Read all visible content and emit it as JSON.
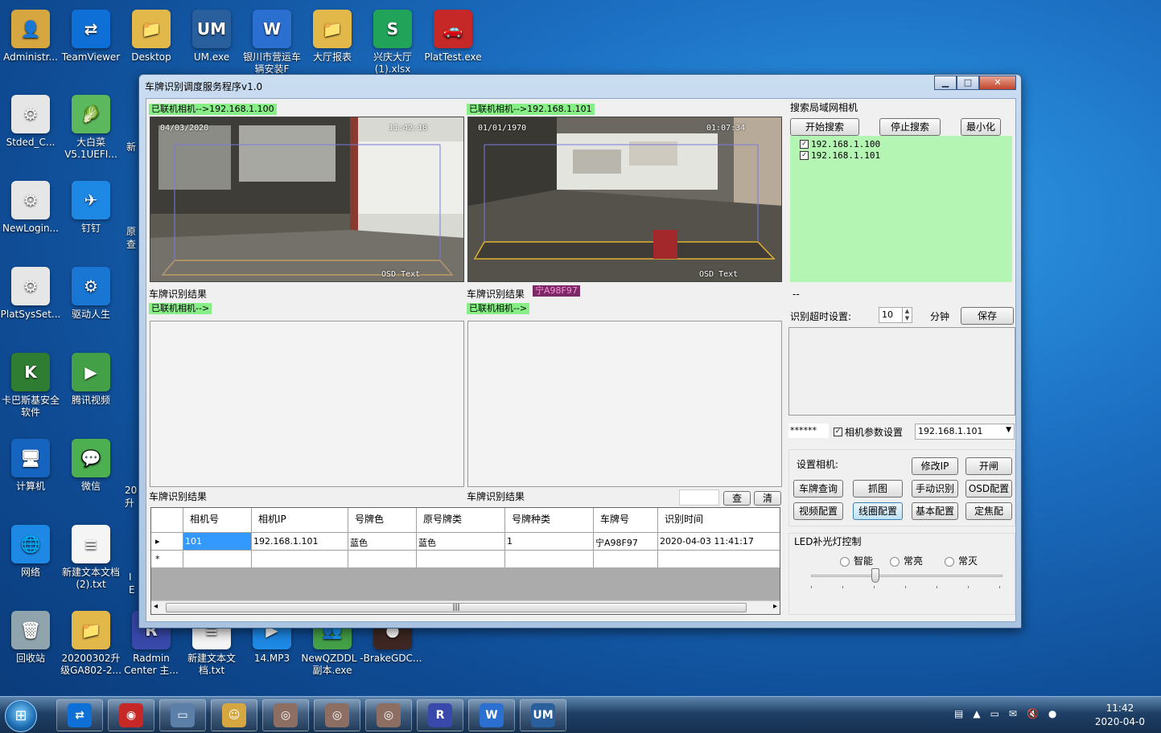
{
  "desktop": {
    "icons": [
      {
        "label": "Administr...",
        "color": "#d6a640",
        "glyph": "👤"
      },
      {
        "label": "TeamViewer",
        "color": "#0e6fd6",
        "glyph": "⇄"
      },
      {
        "label": "Desktop",
        "color": "#e2b84a",
        "glyph": "📁"
      },
      {
        "label": "UM.exe",
        "color": "#2a5f9e",
        "glyph": "UM"
      },
      {
        "label": "银川市营运车辆安装F",
        "color": "#2b6fd0",
        "glyph": "W"
      },
      {
        "label": "大厅报表",
        "color": "#e2b84a",
        "glyph": "📁"
      },
      {
        "label": "兴庆大厅(1).xlsx",
        "color": "#21a35a",
        "glyph": "S"
      },
      {
        "label": "PlatTest.exe",
        "color": "#c62828",
        "glyph": "🚗"
      },
      {
        "label": "Stded_C...",
        "color": "#e6e6e6",
        "glyph": "⚙"
      },
      {
        "label": "大白菜V5.1UEFI...",
        "color": "#5cb85c",
        "glyph": "🥬"
      },
      {
        "label": "NewLogin...",
        "color": "#e6e6e6",
        "glyph": "⚙"
      },
      {
        "label": "钉钉",
        "color": "#1e88e5",
        "glyph": "✈"
      },
      {
        "label": "PlatSysSet...",
        "color": "#e6e6e6",
        "glyph": "⚙"
      },
      {
        "label": "驱动人生",
        "color": "#1976d2",
        "glyph": "⚙"
      },
      {
        "label": "卡巴斯基安全软件",
        "color": "#2e7d32",
        "glyph": "K"
      },
      {
        "label": "腾讯视频",
        "color": "#43a047",
        "glyph": "▶"
      },
      {
        "label": "计算机",
        "color": "#1565c0",
        "glyph": "🖥"
      },
      {
        "label": "微信",
        "color": "#4caf50",
        "glyph": "💬"
      },
      {
        "label": "网络",
        "color": "#1e88e5",
        "glyph": "🌐"
      },
      {
        "label": "新建文本文档 (2).txt",
        "color": "#f5f5f5",
        "glyph": "≡"
      },
      {
        "label": "回收站",
        "color": "#90a4ae",
        "glyph": "🗑"
      },
      {
        "label": "20200302升级GA802-2...",
        "color": "#e2b84a",
        "glyph": "📁"
      },
      {
        "label": "Radmin Center 主...",
        "color": "#3949ab",
        "glyph": "R"
      },
      {
        "label": "新建文本文档.txt",
        "color": "#f5f5f5",
        "glyph": "≡"
      },
      {
        "label": "14.MP3",
        "color": "#1e88e5",
        "glyph": "▶"
      },
      {
        "label": "NewQZDDL - 副本.exe",
        "color": "#43a047",
        "glyph": "👥"
      },
      {
        "label": "BrakeGDC...",
        "color": "#3e2723",
        "glyph": "●"
      }
    ],
    "partial_labels": [
      "新",
      "原\n查",
      "20\n升",
      "I\nE"
    ]
  },
  "window": {
    "title": "车牌识别调度服务程序v1.0",
    "controls": {
      "minimize": "▁",
      "maximize": "□",
      "close": "✕"
    },
    "camera1": {
      "status": "已联机相机-->192.168.1.100",
      "osd_date": "04/03/2020",
      "osd_time": "11:42:18",
      "osd_text": "OSD Text",
      "result_label": "车牌识别结果",
      "result_plate": ""
    },
    "camera2": {
      "status": "已联机相机-->192.168.1.101",
      "osd_date": "01/01/1970",
      "osd_time": "01:07:34",
      "osd_text": "OSD Text",
      "result_label": "车牌识别结果",
      "result_plate": "宁A98F97"
    },
    "camera3": {
      "status": "已联机相机-->",
      "result_label": "车牌识别结果"
    },
    "camera4": {
      "status": "已联机相机-->",
      "result_label": "车牌识别结果"
    },
    "query": {
      "input_value": "",
      "btn_query": "查",
      "btn_clear": "清"
    },
    "search": {
      "title": "搜索局域网相机",
      "start_btn": "开始搜索",
      "stop_btn": "停止搜索",
      "min_btn": "最小化",
      "items": [
        {
          "ip": "192.168.1.100",
          "checked": "✓"
        },
        {
          "ip": "192.168.1.101",
          "checked": "✓"
        }
      ]
    },
    "dash": "--",
    "timeout": {
      "label": "识别超时设置:",
      "value": "10",
      "unit": "分钟",
      "save_btn": "保存"
    },
    "params": {
      "password": "******",
      "checkbox_label": "相机参数设置",
      "checked": "✓",
      "camera_select": "192.168.1.101"
    },
    "camera_settings": {
      "label": "设置相机:",
      "buttons": [
        "修改IP",
        "开闸",
        "车牌查询",
        "抓图",
        "手动识别",
        "OSD配置",
        "视频配置",
        "线圈配置",
        "基本配置",
        "定焦配"
      ]
    },
    "led": {
      "title": "LED补光灯控制",
      "options": [
        "智能",
        "常亮",
        "常灭"
      ],
      "slider_level": 0.33
    },
    "grid": {
      "columns": [
        "",
        "相机号",
        "相机IP",
        "号牌色",
        "原号牌类",
        "号牌种类",
        "车牌号",
        "识别时间"
      ],
      "rows": [
        {
          "indicator": "▸",
          "cells": [
            "101",
            "192.168.1.101",
            "蓝色",
            "蓝色",
            "1",
            "宁A98F97",
            "2020-04-03 11:41:17"
          ]
        },
        {
          "indicator": "*",
          "cells": [
            "",
            "",
            "",
            "",
            "",
            "",
            ""
          ]
        }
      ],
      "scroll_left": "◂",
      "scroll_right": "▸",
      "scroll_grip": "|||"
    }
  },
  "taskbar": {
    "start": "⊞",
    "items": [
      {
        "name": "teamviewer",
        "color": "#0e6fd6",
        "glyph": "⇄"
      },
      {
        "name": "app-colorful",
        "color": "#c62828",
        "glyph": "◉"
      },
      {
        "name": "window",
        "color": "#5c7fa8",
        "glyph": "▭"
      },
      {
        "name": "avatar-app",
        "color": "#d6a640",
        "glyph": "☺"
      },
      {
        "name": "plate-app-1",
        "color": "#8d6e63",
        "glyph": "◎"
      },
      {
        "name": "plate-app-2",
        "color": "#8d6e63",
        "glyph": "◎"
      },
      {
        "name": "plate-app-3",
        "color": "#8d6e63",
        "glyph": "◎"
      },
      {
        "name": "radmin",
        "color": "#3949ab",
        "glyph": "R"
      },
      {
        "name": "wps",
        "color": "#2b6fd0",
        "glyph": "W"
      },
      {
        "name": "um",
        "color": "#2a5f9e",
        "glyph": "UM"
      }
    ],
    "tray": {
      "time": "11:42",
      "date": "2020-04-0"
    }
  }
}
